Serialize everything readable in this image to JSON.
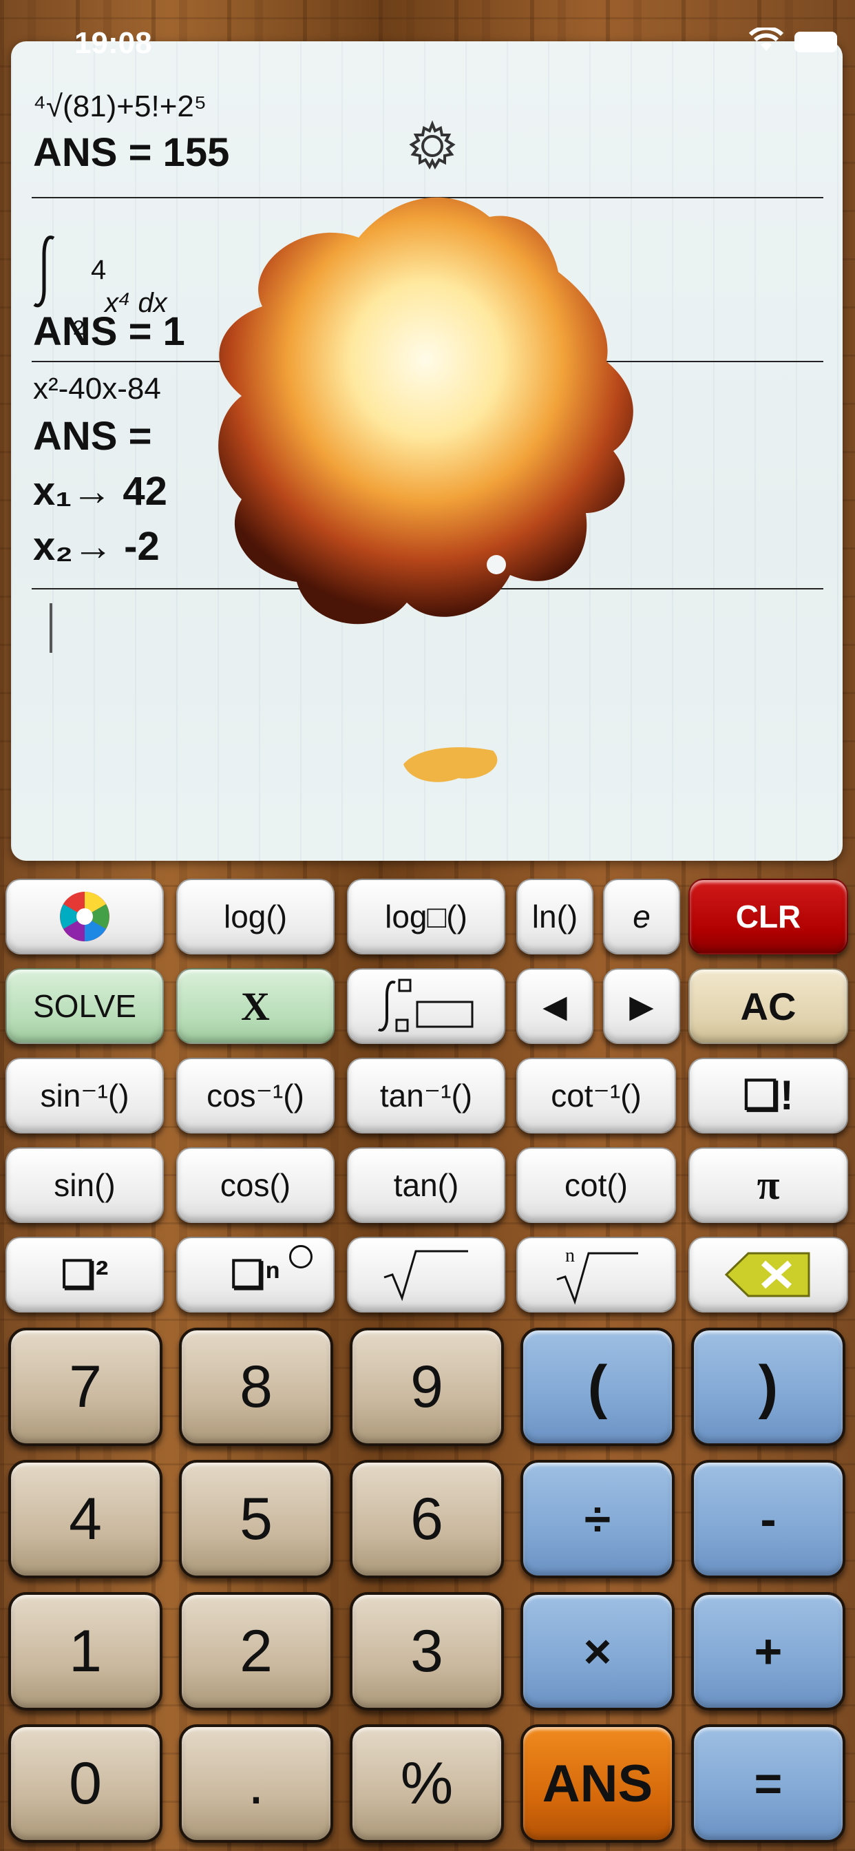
{
  "status_bar": {
    "time": "19:08"
  },
  "display": {
    "entries": [
      {
        "expression": "⁴√(81)+5!+2⁵",
        "answer": "ANS = 155"
      },
      {
        "integral_upper": "4",
        "integral_lower": "2",
        "integrand": "x⁴ dx",
        "answer": "ANS = 1"
      },
      {
        "expression": "x²-40x-84",
        "answer": "ANS =",
        "root1": "x₁→ 42",
        "root2": "x₂→ -2"
      }
    ]
  },
  "keys": {
    "row1": [
      "log()",
      "log□()",
      "ln()",
      "e",
      "CLR"
    ],
    "row2": [
      "SOLVE",
      "X",
      "◀",
      "▶",
      "AC"
    ],
    "row3": [
      "sin⁻¹()",
      "cos⁻¹()",
      "tan⁻¹()",
      "cot⁻¹()",
      "❏!"
    ],
    "row4": [
      "sin()",
      "cos()",
      "tan()",
      "cot()",
      "π"
    ],
    "row5": [
      "❏²",
      "❏ⁿ",
      "√",
      "ⁿ√"
    ],
    "num1": [
      "7",
      "8",
      "9",
      "(",
      ")"
    ],
    "num2": [
      "4",
      "5",
      "6",
      "÷",
      "-"
    ],
    "num3": [
      "1",
      "2",
      "3",
      "×",
      "+"
    ],
    "num4": [
      "0",
      ".",
      "%",
      "ANS",
      "="
    ]
  },
  "colors": {
    "clr": "#b00000",
    "solve": "#b6dcb6",
    "ac": "#e0d2ad",
    "number_keys": "#c9b79d",
    "operator_keys": "#7fa6d3",
    "ans_key": "#d4680a"
  }
}
